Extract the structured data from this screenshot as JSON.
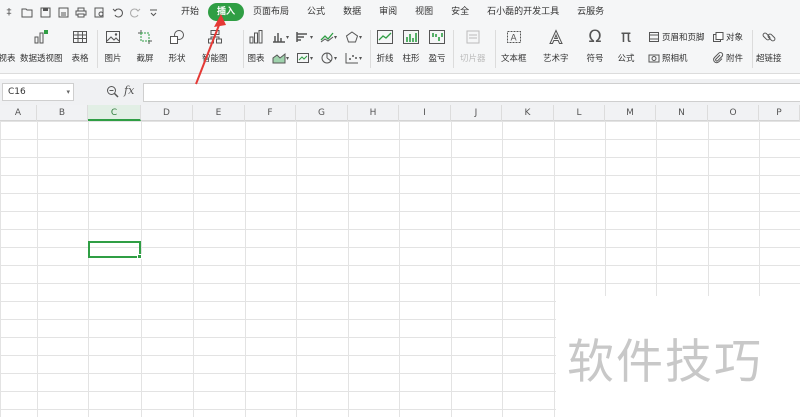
{
  "quick_access": {
    "leading": "‡",
    "items": [
      "open",
      "save",
      "export",
      "print",
      "print-preview",
      "undo",
      "redo",
      "more"
    ]
  },
  "menu": {
    "items": [
      {
        "label": "开始",
        "active": false
      },
      {
        "label": "插入",
        "active": true
      },
      {
        "label": "页面布局",
        "active": false
      },
      {
        "label": "公式",
        "active": false
      },
      {
        "label": "数据",
        "active": false
      },
      {
        "label": "审阅",
        "active": false
      },
      {
        "label": "视图",
        "active": false
      },
      {
        "label": "安全",
        "active": false
      },
      {
        "label": "石小磊的开发工具",
        "active": false
      },
      {
        "label": "云服务",
        "active": false
      }
    ]
  },
  "ribbon": {
    "pivot_table_partial": "视表",
    "pivot_chart": "数据透视图",
    "table": "表格",
    "picture": "图片",
    "screenshot": "截屏",
    "shapes": "形状",
    "smart_art": "智能图",
    "chart": "图表",
    "line": "折线",
    "column": "柱形",
    "win_loss": "盈亏",
    "slicer": "切片器",
    "text_box": "文本框",
    "word_art": "艺术字",
    "symbol": "符号",
    "formula": "公式",
    "header_footer": "页眉和页脚",
    "object": "对象",
    "camera": "照相机",
    "attachment": "附件",
    "hyperlink": "超链接"
  },
  "formula_bar": {
    "name_box": "C16",
    "fx_label": "fx",
    "value": ""
  },
  "columns": [
    "A",
    "B",
    "C",
    "D",
    "E",
    "F",
    "G",
    "H",
    "I",
    "J",
    "K",
    "L",
    "M",
    "N",
    "O",
    "P"
  ],
  "selected_cell": "C16",
  "watermark": "软件技巧",
  "colors": {
    "accent": "#2f9e44",
    "arrow": "#e53935"
  }
}
